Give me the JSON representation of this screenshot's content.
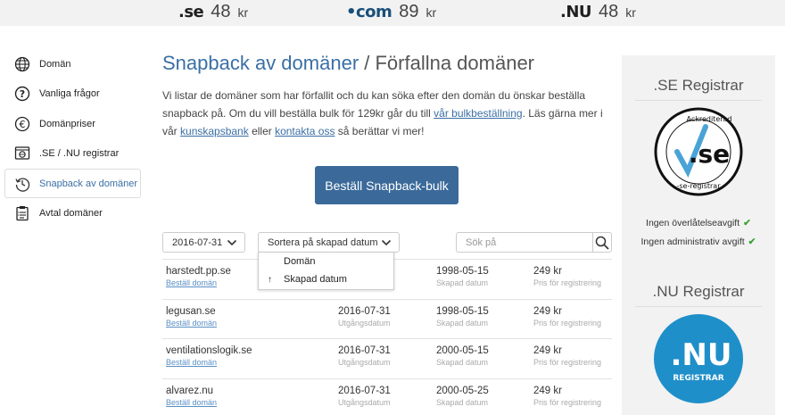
{
  "topbar": {
    "prices": [
      {
        "tld": ".se",
        "amount": "48",
        "unit": "kr"
      },
      {
        "tld": "•com",
        "amount": "89",
        "unit": "kr"
      },
      {
        "tld": ".NU",
        "amount": "48",
        "unit": "kr"
      }
    ]
  },
  "sidebar": {
    "items": [
      {
        "label": "Domän",
        "icon": "globe-icon"
      },
      {
        "label": "Vanliga frågor",
        "icon": "question-icon"
      },
      {
        "label": "Domänpriser",
        "icon": "euro-icon"
      },
      {
        "label": ".SE / .NU registrar",
        "icon": "web-registrar-icon"
      },
      {
        "label": "Snapback av domäner",
        "icon": "history-icon",
        "active": true
      },
      {
        "label": "Avtal domäner",
        "icon": "clipboard-icon"
      }
    ]
  },
  "main": {
    "title_accent": "Snapback av domäner",
    "title_rest": " / Förfallna domäner",
    "intro_1": "Vi listar de domäner som har förfallit och du kan söka efter den domän du önskar beställa snapback på. Om du vill beställa bulk för 129kr går du till ",
    "link_bulk": "vår bulkbeställning",
    "intro_2": ". Läs gärna mer i vår ",
    "link_kb": "kunskapsbank",
    "intro_3": " eller ",
    "link_contact": "kontakta oss",
    "intro_4": " så berättar vi mer!",
    "bulk_button": "Beställ Snapback-bulk",
    "date_select": "2016-07-31",
    "sort_select": "Sortera på skapad datum",
    "search_placeholder": "Sök på",
    "sort_options": [
      {
        "label": "Domän",
        "arrow": ""
      },
      {
        "label": "Skapad datum",
        "arrow": "↑"
      }
    ],
    "rows": [
      {
        "domain": "harstedt.pp.se",
        "order": "Beställ domän",
        "expire": "",
        "expire_label": "",
        "created": "1998-05-15",
        "created_label": "Skapad datum",
        "price": "249 kr",
        "price_label": "Pris för registrering"
      },
      {
        "domain": "legusan.se",
        "order": "Beställ domän",
        "expire": "2016-07-31",
        "expire_label": "Utgångsdatum",
        "created": "1998-05-15",
        "created_label": "Skapad datum",
        "price": "249 kr",
        "price_label": "Pris för registrering"
      },
      {
        "domain": "ventilationslogik.se",
        "order": "Beställ domän",
        "expire": "2016-07-31",
        "expire_label": "Utgångsdatum",
        "created": "2000-05-15",
        "created_label": "Skapad datum",
        "price": "249 kr",
        "price_label": "Pris för registrering"
      },
      {
        "domain": "alvarez.nu",
        "order": "Beställ domän",
        "expire": "2016-07-31",
        "expire_label": "Utgångsdatum",
        "created": "2000-05-25",
        "created_label": "Skapad datum",
        "price": "249 kr",
        "price_label": "Pris för registrering"
      }
    ]
  },
  "panel": {
    "se_title": ".SE Registrar",
    "se_logo_top": "Ackrediterad",
    "se_logo_mid": ".se",
    "se_logo_bottom": "-se-registrar",
    "feature_1": "Ingen överlåtelseavgift",
    "feature_2": "Ingen administrativ avgift",
    "nu_title": ".NU Registrar",
    "nu_logo_mid": ".NU",
    "nu_logo_bottom": "REGISTRAR"
  },
  "colors": {
    "accent": "#3a6fa5",
    "button": "#3b6a9a",
    "check": "#3aa335",
    "nu_blue": "#1f8fc9"
  }
}
